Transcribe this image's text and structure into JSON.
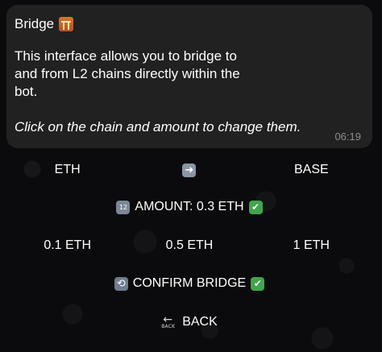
{
  "message": {
    "title": "Bridge",
    "title_icon": "bridge-at-night-icon",
    "body_line1": "This interface allows you to bridge to",
    "body_line2": "and from L2 chains directly within the",
    "body_line3": "bot.",
    "note": "Click on the chain and amount to change them.",
    "time": "06:19"
  },
  "keyboard": {
    "from_chain": "ETH",
    "arrow_icon": "right-arrow-icon",
    "to_chain": "BASE",
    "amount_label": "AMOUNT: 0.3 ETH",
    "amounts": [
      "0.1 ETH",
      "0.5 ETH",
      "1 ETH"
    ],
    "confirm_label": "CONFIRM BRIDGE",
    "back_label": "BACK"
  },
  "colors": {
    "background": "#0b0b0d",
    "bubble": "#212121",
    "timestamp": "#8e8e93",
    "check": "#3fa54a"
  }
}
